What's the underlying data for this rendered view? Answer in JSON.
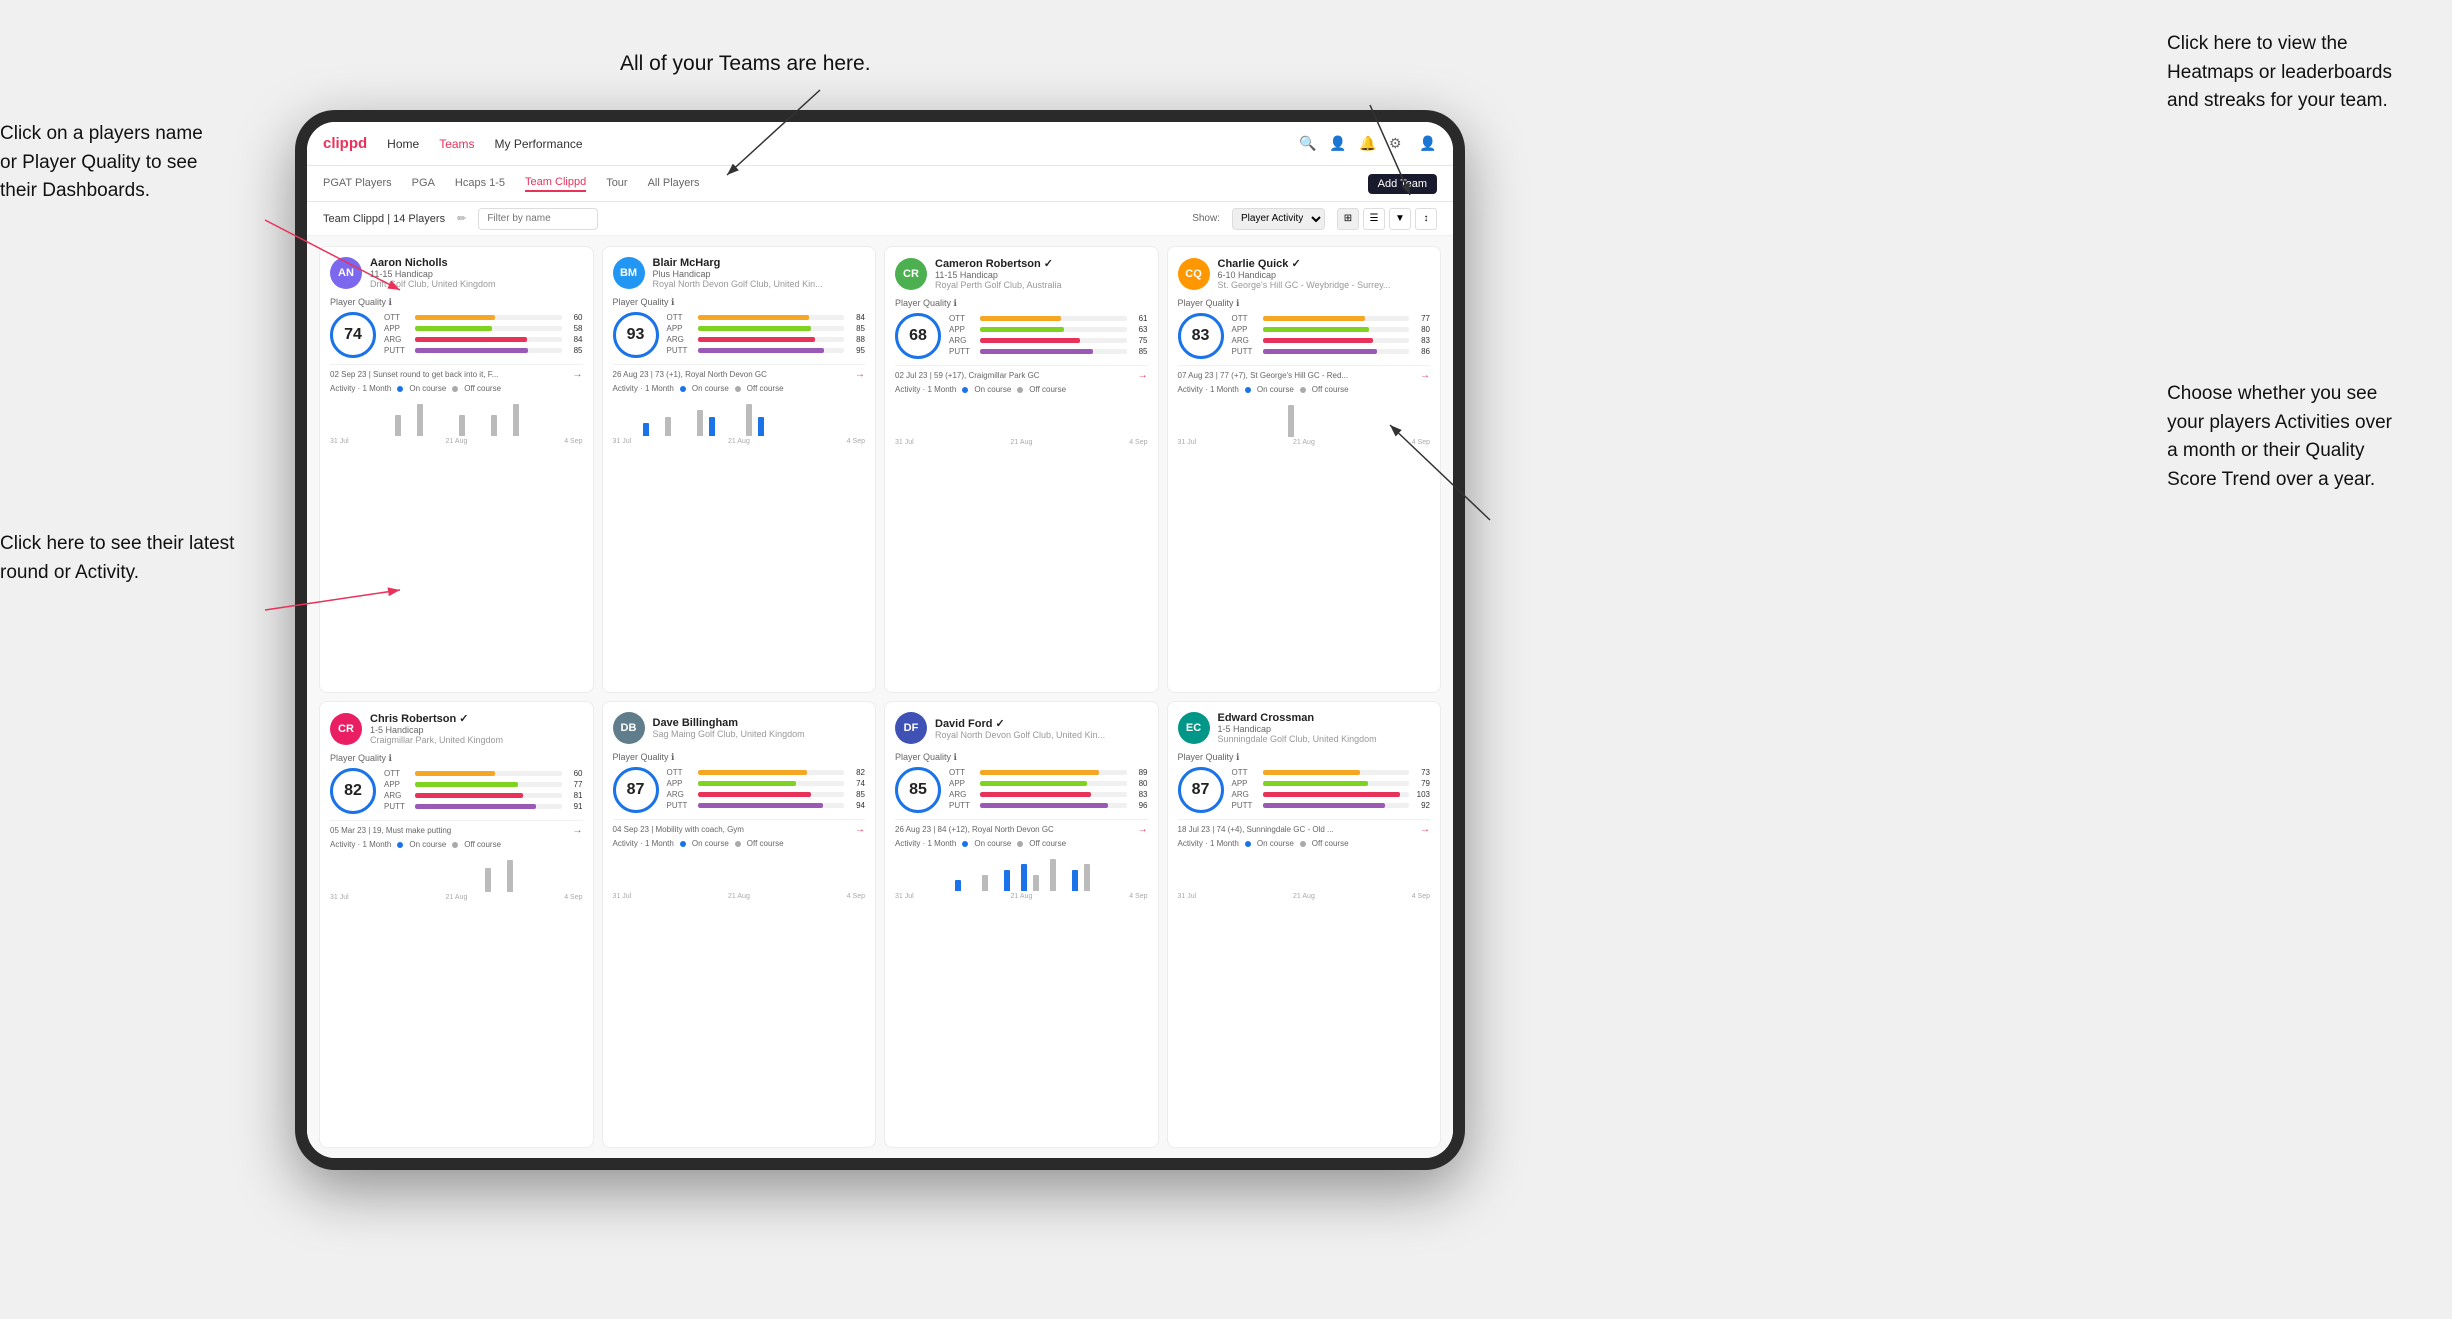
{
  "annotations": {
    "top_teams": "All of your Teams are here.",
    "top_right_heatmaps": "Click here to view the\nHeatmaps or leaderboards\nand streaks for your team.",
    "left_click_name": "Click on a players name\nor Player Quality to see\ntheir Dashboards.",
    "left_bottom_round": "Click here to see their latest\nround or Activity.",
    "right_bottom_activities": "Choose whether you see\nyour players Activities over\na month or their Quality\nScore Trend over a year."
  },
  "nav": {
    "logo": "clippd",
    "links": [
      "Home",
      "Teams",
      "My Performance"
    ],
    "add_team": "Add Team"
  },
  "tabs": {
    "items": [
      "PGAT Players",
      "PGA",
      "Hcaps 1-5",
      "Team Clippd",
      "Tour",
      "All Players"
    ],
    "active": "Team Clippd"
  },
  "filter": {
    "team_label": "Team Clippd | 14 Players",
    "search_placeholder": "Filter by name",
    "show_label": "Show:",
    "show_value": "Player Activity"
  },
  "players": [
    {
      "name": "Aaron Nicholls",
      "handicap": "11-15 Handicap",
      "club": "Drift Golf Club, United Kingdom",
      "quality": 74,
      "circle_color": "#1a73e8",
      "stats": [
        {
          "name": "OTT",
          "value": 60,
          "color": "#f5a623"
        },
        {
          "name": "APP",
          "value": 58,
          "color": "#7ed321"
        },
        {
          "name": "ARG",
          "value": 84,
          "color": "#e8325a"
        },
        {
          "name": "PUTT",
          "value": 85,
          "color": "#9b59b6"
        }
      ],
      "recent": "02 Sep 23 | Sunset round to get back into it, F...",
      "chart_bars": [
        0,
        0,
        0,
        0,
        0,
        0,
        0,
        0,
        0,
        0,
        0,
        0,
        0,
        2,
        0,
        0,
        0,
        3,
        0,
        0,
        0,
        0,
        0,
        0,
        0,
        2,
        0,
        0,
        0,
        0,
        0,
        2,
        0,
        0,
        0,
        3,
        0,
        0,
        0,
        0
      ],
      "avatar_color": "#7b68ee",
      "initials": "AN"
    },
    {
      "name": "Blair McHarg",
      "handicap": "Plus Handicap",
      "club": "Royal North Devon Golf Club, United Kin...",
      "quality": 93,
      "circle_color": "#1a73e8",
      "stats": [
        {
          "name": "OTT",
          "value": 84,
          "color": "#f5a623"
        },
        {
          "name": "APP",
          "value": 85,
          "color": "#7ed321"
        },
        {
          "name": "ARG",
          "value": 88,
          "color": "#e8325a"
        },
        {
          "name": "PUTT",
          "value": 95,
          "color": "#9b59b6"
        }
      ],
      "recent": "26 Aug 23 | 73 (+1), Royal North Devon GC",
      "chart_bars": [
        0,
        0,
        0,
        0,
        0,
        0,
        2,
        0,
        0,
        0,
        3,
        0,
        0,
        0,
        0,
        0,
        4,
        0,
        3,
        0,
        0,
        0,
        0,
        0,
        0,
        5,
        0,
        3,
        0,
        0,
        0,
        0,
        0,
        0,
        0,
        0,
        0,
        0,
        0,
        0
      ],
      "avatar_color": "#2196f3",
      "initials": "BM"
    },
    {
      "name": "Cameron Robertson",
      "handicap": "11-15 Handicap",
      "club": "Royal Perth Golf Club, Australia",
      "quality": 68,
      "circle_color": "#1a73e8",
      "stats": [
        {
          "name": "OTT",
          "value": 61,
          "color": "#f5a623"
        },
        {
          "name": "APP",
          "value": 63,
          "color": "#7ed321"
        },
        {
          "name": "ARG",
          "value": 75,
          "color": "#e8325a"
        },
        {
          "name": "PUTT",
          "value": 85,
          "color": "#9b59b6"
        }
      ],
      "recent": "02 Jul 23 | 59 (+17), Craigmillar Park GC",
      "chart_bars": [
        0,
        0,
        0,
        0,
        0,
        0,
        0,
        0,
        0,
        0,
        0,
        0,
        0,
        0,
        0,
        0,
        0,
        0,
        0,
        0,
        0,
        0,
        0,
        0,
        0,
        0,
        0,
        0,
        0,
        0,
        0,
        0,
        0,
        0,
        0,
        0,
        0,
        0,
        0,
        0
      ],
      "avatar_color": "#4caf50",
      "initials": "CR"
    },
    {
      "name": "Charlie Quick",
      "handicap": "6-10 Handicap",
      "club": "St. George's Hill GC - Weybridge - Surrey...",
      "quality": 83,
      "circle_color": "#1a73e8",
      "stats": [
        {
          "name": "OTT",
          "value": 77,
          "color": "#f5a623"
        },
        {
          "name": "APP",
          "value": 80,
          "color": "#7ed321"
        },
        {
          "name": "ARG",
          "value": 83,
          "color": "#e8325a"
        },
        {
          "name": "PUTT",
          "value": 86,
          "color": "#9b59b6"
        }
      ],
      "recent": "07 Aug 23 | 77 (+7), St George's Hill GC - Red...",
      "chart_bars": [
        0,
        0,
        0,
        0,
        0,
        0,
        0,
        0,
        0,
        0,
        0,
        0,
        0,
        0,
        0,
        0,
        0,
        0,
        0,
        0,
        0,
        0,
        3,
        0,
        0,
        0,
        0,
        0,
        0,
        0,
        0,
        0,
        0,
        0,
        0,
        0,
        0,
        0,
        0,
        0
      ],
      "avatar_color": "#ff9800",
      "initials": "CQ"
    },
    {
      "name": "Chris Robertson",
      "handicap": "1-5 Handicap",
      "club": "Craigmillar Park, United Kingdom",
      "quality": 82,
      "circle_color": "#1a73e8",
      "stats": [
        {
          "name": "OTT",
          "value": 60,
          "color": "#f5a623"
        },
        {
          "name": "APP",
          "value": 77,
          "color": "#7ed321"
        },
        {
          "name": "ARG",
          "value": 81,
          "color": "#e8325a"
        },
        {
          "name": "PUTT",
          "value": 91,
          "color": "#9b59b6"
        }
      ],
      "recent": "05 Mar 23 | 19, Must make putting",
      "chart_bars": [
        0,
        0,
        0,
        0,
        0,
        0,
        0,
        0,
        0,
        0,
        0,
        0,
        0,
        0,
        0,
        0,
        0,
        0,
        0,
        0,
        0,
        0,
        0,
        0,
        0,
        0,
        0,
        0,
        0,
        0,
        0,
        3,
        0,
        0,
        0,
        4,
        0,
        0,
        0,
        0
      ],
      "avatar_color": "#e91e63",
      "initials": "CR"
    },
    {
      "name": "Dave Billingham",
      "handicap": "",
      "club": "Sag Maing Golf Club, United Kingdom",
      "quality": 87,
      "circle_color": "#1a73e8",
      "stats": [
        {
          "name": "OTT",
          "value": 82,
          "color": "#f5a623"
        },
        {
          "name": "APP",
          "value": 74,
          "color": "#7ed321"
        },
        {
          "name": "ARG",
          "value": 85,
          "color": "#e8325a"
        },
        {
          "name": "PUTT",
          "value": 94,
          "color": "#9b59b6"
        }
      ],
      "recent": "04 Sep 23 | Mobility with coach, Gym",
      "chart_bars": [
        0,
        0,
        0,
        0,
        0,
        0,
        0,
        0,
        0,
        0,
        0,
        0,
        0,
        0,
        0,
        0,
        0,
        0,
        0,
        0,
        0,
        0,
        0,
        0,
        0,
        0,
        0,
        0,
        0,
        0,
        0,
        0,
        0,
        0,
        0,
        0,
        0,
        0,
        0,
        0
      ],
      "avatar_color": "#607d8b",
      "initials": "DB"
    },
    {
      "name": "David Ford",
      "handicap": "",
      "club": "Royal North Devon Golf Club, United Kin...",
      "quality": 85,
      "circle_color": "#1a73e8",
      "stats": [
        {
          "name": "OTT",
          "value": 89,
          "color": "#f5a623"
        },
        {
          "name": "APP",
          "value": 80,
          "color": "#7ed321"
        },
        {
          "name": "ARG",
          "value": 83,
          "color": "#e8325a"
        },
        {
          "name": "PUTT",
          "value": 96,
          "color": "#9b59b6"
        }
      ],
      "recent": "26 Aug 23 | 84 (+12), Royal North Devon GC",
      "chart_bars": [
        0,
        0,
        0,
        0,
        0,
        0,
        0,
        0,
        0,
        0,
        0,
        0,
        2,
        0,
        0,
        0,
        0,
        3,
        0,
        0,
        0,
        4,
        0,
        0,
        5,
        0,
        3,
        0,
        0,
        6,
        0,
        0,
        0,
        4,
        0,
        5,
        0,
        0,
        0,
        0
      ],
      "avatar_color": "#3f51b5",
      "initials": "DF"
    },
    {
      "name": "Edward Crossman",
      "handicap": "1-5 Handicap",
      "club": "Sunningdale Golf Club, United Kingdom",
      "quality": 87,
      "circle_color": "#1a73e8",
      "stats": [
        {
          "name": "OTT",
          "value": 73,
          "color": "#f5a623"
        },
        {
          "name": "APP",
          "value": 79,
          "color": "#7ed321"
        },
        {
          "name": "ARG",
          "value": 103,
          "color": "#e8325a"
        },
        {
          "name": "PUTT",
          "value": 92,
          "color": "#9b59b6"
        }
      ],
      "recent": "18 Jul 23 | 74 (+4), Sunningdale GC - Old ...",
      "chart_bars": [
        0,
        0,
        0,
        0,
        0,
        0,
        0,
        0,
        0,
        0,
        0,
        0,
        0,
        0,
        0,
        0,
        0,
        0,
        0,
        0,
        0,
        0,
        0,
        0,
        0,
        0,
        0,
        0,
        0,
        0,
        0,
        0,
        0,
        0,
        0,
        0,
        0,
        0,
        0,
        0
      ],
      "avatar_color": "#009688",
      "initials": "EC"
    }
  ],
  "chart_dates": [
    "31 Jul",
    "21 Aug",
    "4 Sep"
  ],
  "activity_legend": {
    "label": "Activity · 1 Month",
    "on_course": "On course",
    "off_course": "Off course",
    "on_color": "#1a73e8",
    "off_color": "#aaa"
  }
}
